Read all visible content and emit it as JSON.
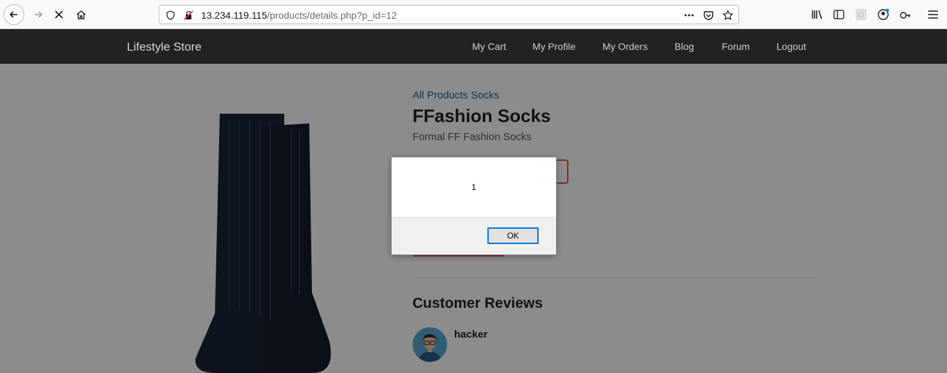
{
  "browser": {
    "url_host": "13.234.119.115",
    "url_path": "/products/details.php?p_id=12"
  },
  "site": {
    "brand": "Lifestyle Store",
    "nav": [
      "My Cart",
      "My Profile",
      "My Orders",
      "Blog",
      "Forum",
      "Logout"
    ]
  },
  "product": {
    "breadcrumb": "All Products Socks",
    "title": "FFashion Socks",
    "subtitle": "Formal FF Fashion Socks"
  },
  "reviews": {
    "heading": "Customer Reviews",
    "items": [
      {
        "user": "hacker"
      }
    ]
  },
  "alert": {
    "message": "1",
    "ok_label": "OK"
  },
  "colors": {
    "navbar_bg": "#222222",
    "link": "#1a5f93",
    "accent_red": "#d9534f",
    "dialog_focus": "#0078d7"
  }
}
